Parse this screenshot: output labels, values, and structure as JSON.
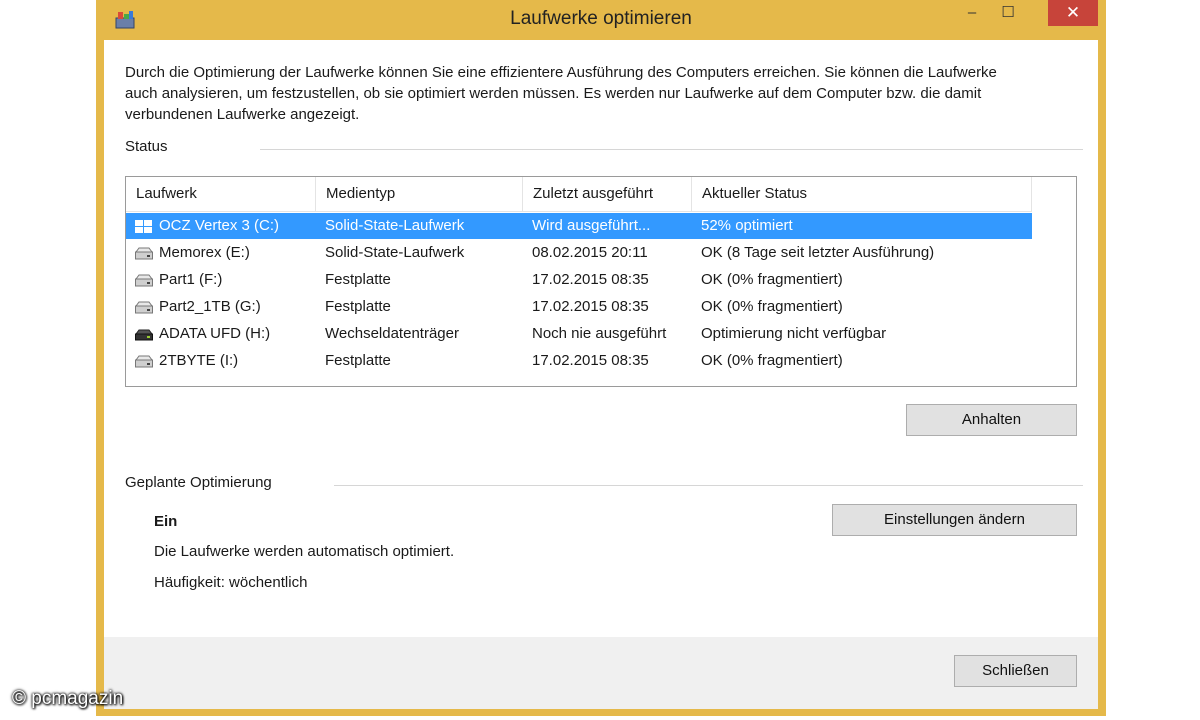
{
  "window": {
    "title": "Laufwerke optimieren",
    "close_glyph": "✕",
    "maximize_glyph": "☐",
    "minimize_glyph": "–"
  },
  "description": "Durch die Optimierung der Laufwerke können Sie eine effizientere Ausführung des Computers erreichen. Sie können die Laufwerke auch analysieren, um festzustellen, ob sie optimiert werden müssen. Es werden nur Laufwerke auf dem Computer bzw. die damit verbundenen Laufwerke angezeigt.",
  "status": {
    "label": "Status",
    "columns": [
      "Laufwerk",
      "Medientyp",
      "Zuletzt ausgeführt",
      "Aktueller Status"
    ],
    "drives": [
      {
        "name": "OCZ Vertex 3 (C:)",
        "media": "Solid-State-Laufwerk",
        "last_run": "Wird ausgeführt...",
        "status": "52% optimiert",
        "icon": "system-drive-icon",
        "selected": true
      },
      {
        "name": "Memorex (E:)",
        "media": "Solid-State-Laufwerk",
        "last_run": "08.02.2015 20:11",
        "status": "OK (8 Tage seit letzter Ausführung)",
        "icon": "hard-drive-icon"
      },
      {
        "name": "Part1 (F:)",
        "media": "Festplatte",
        "last_run": "17.02.2015 08:35",
        "status": "OK (0% fragmentiert)",
        "icon": "hard-drive-icon"
      },
      {
        "name": "Part2_1TB (G:)",
        "media": "Festplatte",
        "last_run": "17.02.2015 08:35",
        "status": "OK (0% fragmentiert)",
        "icon": "hard-drive-icon"
      },
      {
        "name": "ADATA UFD (H:)",
        "media": "Wechseldatenträger",
        "last_run": "Noch nie ausgeführt",
        "status": "Optimierung nicht verfügbar",
        "icon": "usb-drive-icon"
      },
      {
        "name": "2TBYTE (I:)",
        "media": "Festplatte",
        "last_run": "17.02.2015 08:35",
        "status": "OK (0% fragmentiert)",
        "icon": "hard-drive-icon"
      }
    ],
    "stop_button": "Anhalten"
  },
  "schedule": {
    "label": "Geplante Optimierung",
    "state": "Ein",
    "info": "Die Laufwerke werden automatisch optimiert.",
    "frequency": "Häufigkeit: wöchentlich",
    "settings_button": "Einstellungen ändern"
  },
  "close_button": "Schließen",
  "watermark": "© pcmagazin",
  "colors": {
    "window_frame": "#e5b94a",
    "selection": "#3399ff",
    "close_button": "#c7443a"
  }
}
